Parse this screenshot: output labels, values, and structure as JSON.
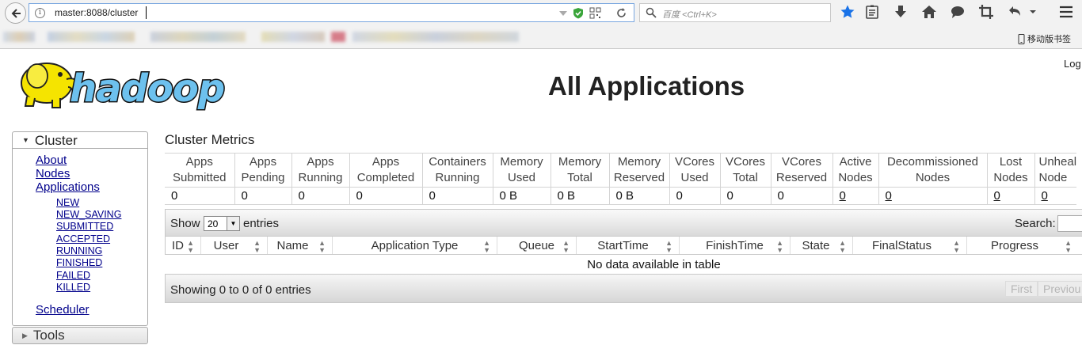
{
  "browser": {
    "url": "master:8088/cluster",
    "search_placeholder": "百度 <Ctrl+K>",
    "mobile_bookmarks": "移动版书签"
  },
  "header": {
    "logo_text": "hadoop",
    "title": "All Applications",
    "login": "Log"
  },
  "sidebar": {
    "cluster_label": "Cluster",
    "links": [
      "About",
      "Nodes",
      "Applications"
    ],
    "app_states": [
      "NEW",
      "NEW_SAVING",
      "SUBMITTED",
      "ACCEPTED",
      "RUNNING",
      "FINISHED",
      "FAILED",
      "KILLED"
    ],
    "scheduler": "Scheduler",
    "tools_label": "Tools"
  },
  "metrics": {
    "heading": "Cluster Metrics",
    "columns": [
      {
        "l1": "Apps",
        "l2": "Submitted",
        "value": "0"
      },
      {
        "l1": "Apps",
        "l2": "Pending",
        "value": "0"
      },
      {
        "l1": "Apps",
        "l2": "Running",
        "value": "0"
      },
      {
        "l1": "Apps",
        "l2": "Completed",
        "value": "0"
      },
      {
        "l1": "Containers",
        "l2": "Running",
        "value": "0"
      },
      {
        "l1": "Memory",
        "l2": "Used",
        "value": "0 B"
      },
      {
        "l1": "Memory",
        "l2": "Total",
        "value": "0 B"
      },
      {
        "l1": "Memory",
        "l2": "Reserved",
        "value": "0 B"
      },
      {
        "l1": "VCores",
        "l2": "Used",
        "value": "0"
      },
      {
        "l1": "VCores",
        "l2": "Total",
        "value": "0"
      },
      {
        "l1": "VCores",
        "l2": "Reserved",
        "value": "0"
      },
      {
        "l1": "Active",
        "l2": "Nodes",
        "value": "0"
      },
      {
        "l1": "Decommissioned",
        "l2": "Nodes",
        "value": "0"
      },
      {
        "l1": "Lost",
        "l2": "Nodes",
        "value": "0"
      },
      {
        "l1": "Unheal",
        "l2": "Node",
        "value": "0"
      }
    ]
  },
  "apps": {
    "show_label": "Show",
    "page_length": "20",
    "entries_label": "entries",
    "search_label": "Search:",
    "columns": [
      "ID",
      "User",
      "Name",
      "Application Type",
      "Queue",
      "StartTime",
      "FinishTime",
      "State",
      "FinalStatus",
      "Progress"
    ],
    "empty_message": "No data available in table",
    "info": "Showing 0 to 0 of 0 entries",
    "pager": {
      "first": "First",
      "previous": "Previou"
    }
  }
}
